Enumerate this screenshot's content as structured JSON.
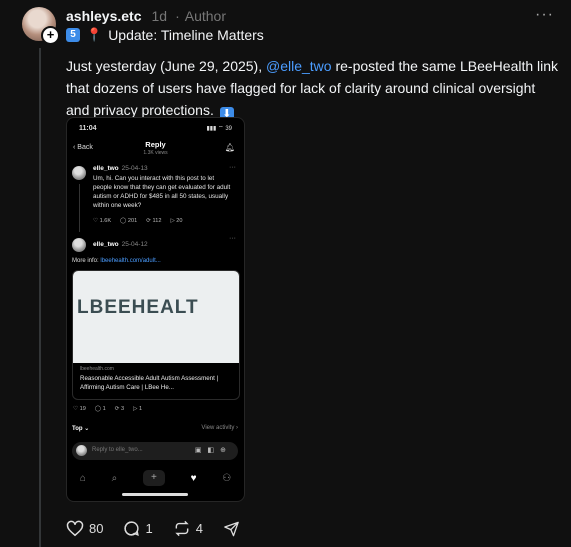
{
  "post": {
    "username": "ashleys.etc",
    "time_ago": "1d",
    "author_label": "Author",
    "update_keycap": "5",
    "update_title": "Update: Timeline Matters",
    "body_pre": "Just yesterday (June 29, 2025), ",
    "mention": "@elle_two",
    "body_post": " re-posted the same LBeeHealth link that dozens of users have flagged for lack of clarity around clinical oversight and privacy protections. ",
    "arrow_keycap": "⬇",
    "counts": {
      "likes": "80",
      "replies": "1",
      "reposts": "4"
    }
  },
  "screenshot": {
    "status_time": "11:04",
    "status_right": "▮▮▮ ⌔ 39",
    "back_label": "Back",
    "title": "Reply",
    "subtitle": "1.3K views",
    "reply1": {
      "name": "elle_two",
      "date": "25-04-13",
      "text": "Um, hi. Can you interact with this post to let people know that they can get evaluated for adult autism or ADHD for $485 in all 50 states, usually within one week?",
      "likes": "1.6K",
      "replies": "201",
      "reposts": "112",
      "shares": "20"
    },
    "reply2": {
      "name": "elle_two",
      "date": "25-04-12",
      "more_info_label": "More info:",
      "more_info_link": "lbeehealth.com/adult...",
      "card_brand": "LBEEHEALT",
      "card_domain": "lbeehealth.com",
      "card_title": "Reasonable Accessible Adult Autism Assessment | Affirming Autism Care | LBee He...",
      "likes": "19",
      "replies": "1",
      "reposts": "3",
      "shares": "1"
    },
    "top_label": "Top",
    "view_activity": "View activity",
    "reply_placeholder": "Reply to elle_two..."
  }
}
